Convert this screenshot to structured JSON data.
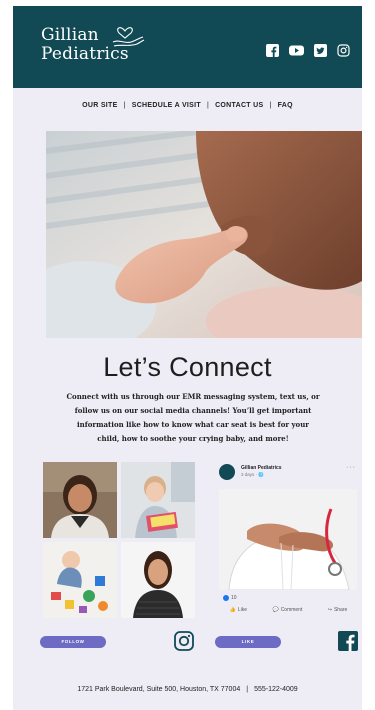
{
  "brand": {
    "line1": "Gillian",
    "line2": "Pediatrics",
    "colors": {
      "header": "#114a55",
      "background": "#eeedf6",
      "button": "#6d6bc3"
    }
  },
  "header_icons": [
    "facebook-icon",
    "youtube-icon",
    "twitter-icon",
    "instagram-icon"
  ],
  "nav": {
    "items": [
      "OUR SITE",
      "SCHEDULE A VISIT",
      "CONTACT US",
      "FAQ"
    ],
    "separator": "|"
  },
  "main": {
    "title": "Let’s Connect",
    "body": "Connect with us through our EMR messaging system, text us, or follow us on our social media channels! You’ll get important information like how to know what car seat is best for your child, how to soothe your crying baby, and more!"
  },
  "facebook_post": {
    "page_name": "Gillian Pediatrics",
    "date": "3 days · ",
    "more": "···",
    "likes_count": "10",
    "actions": [
      "Like",
      "Comment",
      "Share"
    ]
  },
  "social": {
    "follow_label": "FOLLOW",
    "like_label": "LIKE"
  },
  "footer": {
    "address": "1721 Park Boulevard, Suite 500, Houston, TX 77004",
    "separator": "|",
    "phone": "555-122-4009"
  }
}
